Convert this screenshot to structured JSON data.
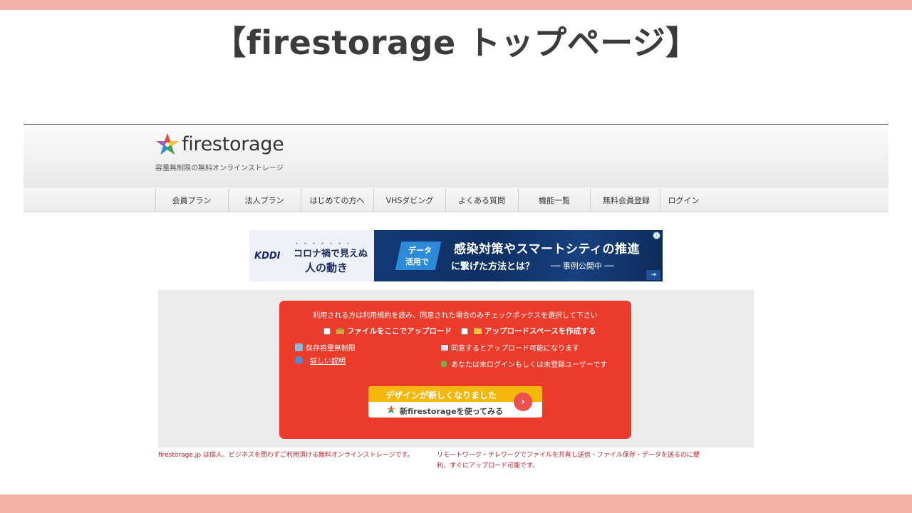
{
  "slide": {
    "title": "【firestorage トップページ】"
  },
  "colors": {
    "band": "#f4b1a8",
    "upload_box": "#ec3b2b",
    "new_design_yellow": "#f5b70c",
    "foot_text": "#c0262c"
  },
  "site": {
    "logo_text": "firestorage",
    "tagline": "容量無制限の無料オンラインストレージ",
    "logo_icon": "flower-star-icon"
  },
  "nav": {
    "items": [
      {
        "label": "会員プラン"
      },
      {
        "label": "法人プラン"
      },
      {
        "label": "はじめての方へ"
      },
      {
        "label": "VHSダビング"
      },
      {
        "label": "よくある質問"
      },
      {
        "label": "機能一覧"
      },
      {
        "label": "無料会員登録"
      },
      {
        "label": "ログイン"
      }
    ]
  },
  "ad": {
    "brand": "KDDI",
    "left_dots": "・・・・・・・",
    "left_line1": "コロナ禍で見えぬ",
    "left_line2": "人の動き",
    "tag_line1": "データ",
    "tag_line2": "活用で",
    "headline1": "感染対策やスマートシティの推進",
    "headline2": "に繋げた方法とは？",
    "case_label": "── 事例公開中 ──",
    "info_icon": "ⓘ",
    "arrow_icon": "⇥"
  },
  "upload": {
    "instruction": "利用される方は利用規約を読み、同意された場合のみチェックボックスを選択して下さい",
    "option_upload": "ファイルをここでアップロード",
    "option_space": "アップロードスペースを作成する",
    "storage_unlimited": "保存容量無制限",
    "details_link": "詳しい説明",
    "agree_note": "同意するとアップロード可能になります",
    "login_status": "あなたは未ログインもしくは未登録ユーザーです",
    "new_design_banner": "デザインが新しくなりました",
    "try_new": "新firestorageを使ってみる",
    "arrow_glyph": "›"
  },
  "footer": {
    "left": "firestorage.jp は個人、ビジネスを問わずご利用頂ける無料オンラインストレージです。",
    "right_line1": "リモートワーク・テレワークでファイルを共有し送信・ファイル保存・データを送るのに便",
    "right_line2": "利、すぐにアップロード可能です。"
  }
}
